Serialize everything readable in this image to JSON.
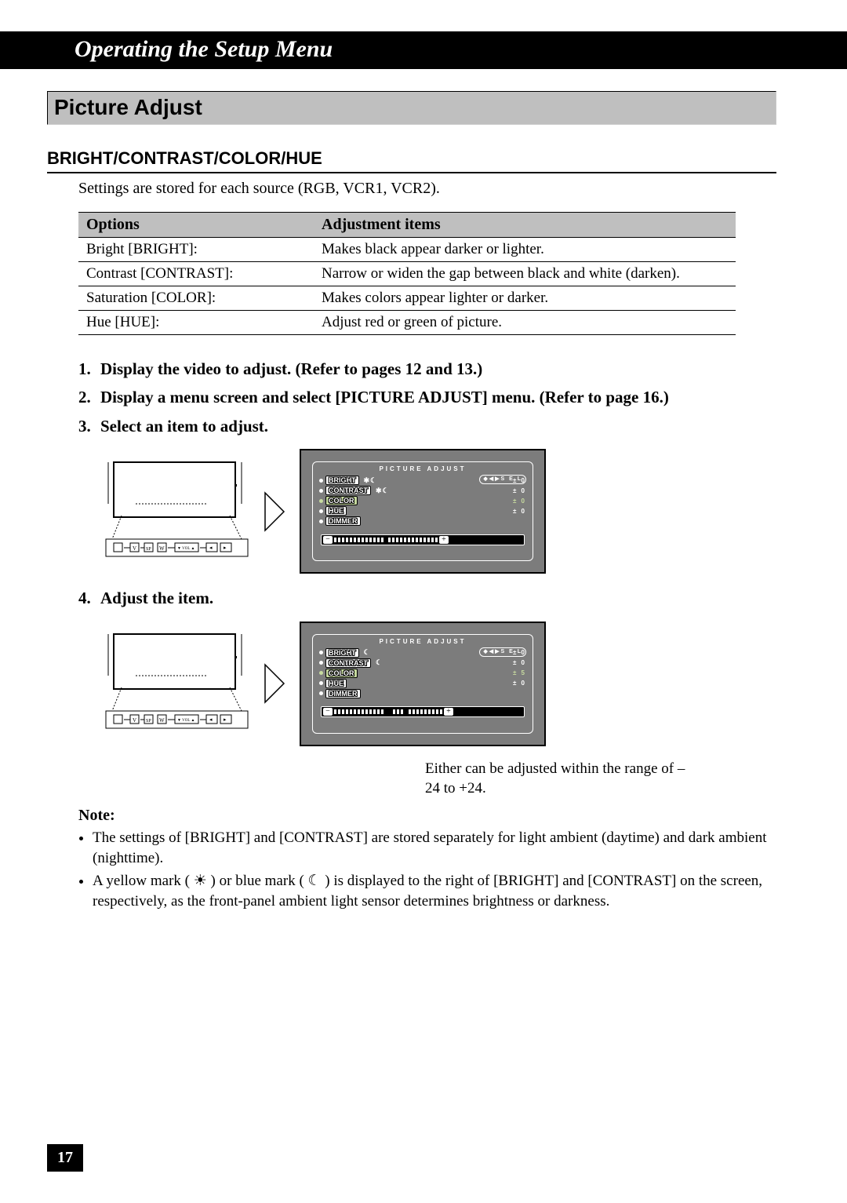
{
  "title": "Operating the Setup Menu",
  "section": "Picture Adjust",
  "subheading": "BRIGHT/CONTRAST/COLOR/HUE",
  "intro": "Settings are stored for each source (RGB, VCR1, VCR2).",
  "table": {
    "headers": [
      "Options",
      "Adjustment items"
    ],
    "rows": [
      [
        "Bright [BRIGHT]:",
        "Makes black appear darker or lighter."
      ],
      [
        "Contrast [CONTRAST]:",
        "Narrow or widen the gap between black and white (darken)."
      ],
      [
        "Saturation [COLOR]:",
        "Makes colors appear lighter or darker."
      ],
      [
        "Hue [HUE]:",
        "Adjust red or green of picture."
      ]
    ]
  },
  "steps": [
    "Display the video to adjust. (Refer to pages 12 and 13.)",
    "Display a menu screen and select [PICTURE ADJUST] menu. (Refer to page 16.)",
    "Select an item to adjust.",
    "Adjust the item."
  ],
  "caption": "Either can be adjusted within the range of –24 to +24.",
  "note_heading": "Note:",
  "notes": [
    "The settings of [BRIGHT] and [CONTRAST] are stored separately for light ambient (daytime) and dark ambient (nighttime).",
    "A yellow mark (  ☀  ) or blue mark (  ☾  ) is displayed to the right of [BRIGHT] and [CONTRAST] on the screen, respectively, as the front-panel ambient light sensor determines brightness or darkness."
  ],
  "page_number": "17",
  "osd": {
    "title": "PICTURE ADJUST",
    "sel_hint": "◆◀▶S E L",
    "items": [
      {
        "label": "BRIGHT",
        "val": "± 0",
        "marks": "✱☾"
      },
      {
        "label": "CONTRAST",
        "val": "± 0",
        "marks": "✱☾"
      },
      {
        "label": "COLOR",
        "val": "± 0",
        "selected": true
      },
      {
        "label": "HUE",
        "val": "± 0"
      },
      {
        "label": "DIMMER",
        "val": ""
      }
    ],
    "items2": [
      {
        "label": "BRIGHT",
        "val": "± 0",
        "marks": "☾"
      },
      {
        "label": "CONTRAST",
        "val": "± 0",
        "marks": "☾"
      },
      {
        "label": "COLOR",
        "val": "± 5",
        "selected": true
      },
      {
        "label": "HUE",
        "val": "± 0"
      },
      {
        "label": "DIMMER",
        "val": ""
      }
    ]
  }
}
